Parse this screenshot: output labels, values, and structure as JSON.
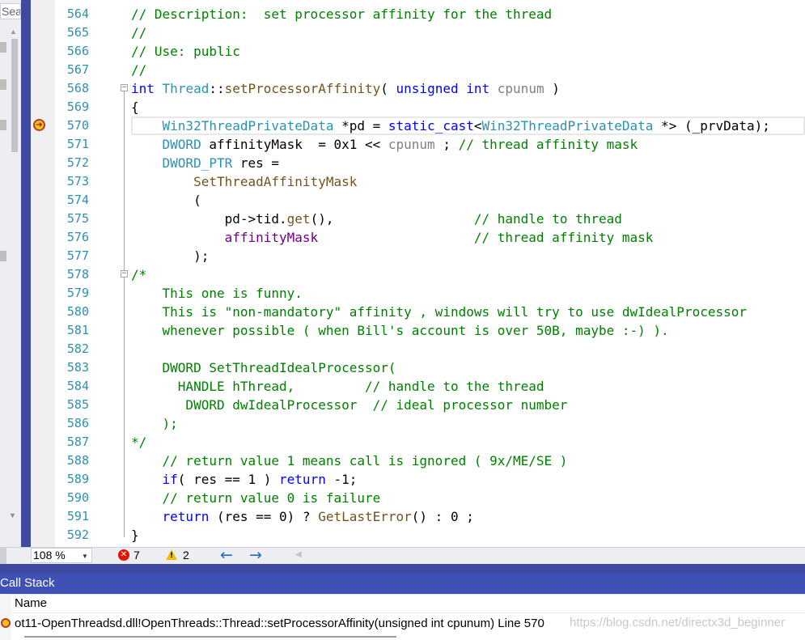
{
  "left_panel": {
    "search_text": "Sear"
  },
  "editor": {
    "lines": [
      {
        "n": "564",
        "segments": [
          {
            "c": "cm",
            "t": "// Description:  set processor affinity for the thread"
          }
        ]
      },
      {
        "n": "565",
        "segments": [
          {
            "c": "cm",
            "t": "//"
          }
        ]
      },
      {
        "n": "566",
        "segments": [
          {
            "c": "cm",
            "t": "// Use: public"
          }
        ]
      },
      {
        "n": "567",
        "segments": [
          {
            "c": "cm",
            "t": "//"
          }
        ]
      },
      {
        "n": "568",
        "segments": [
          {
            "c": "kw",
            "t": "int"
          },
          {
            "c": "",
            "t": " "
          },
          {
            "c": "ty",
            "t": "Thread"
          },
          {
            "c": "",
            "t": "::"
          },
          {
            "c": "fn",
            "t": "setProcessorAffinity"
          },
          {
            "c": "",
            "t": "( "
          },
          {
            "c": "kw",
            "t": "unsigned"
          },
          {
            "c": "",
            "t": " "
          },
          {
            "c": "kw",
            "t": "int"
          },
          {
            "c": "",
            "t": " "
          },
          {
            "c": "pm",
            "t": "cpunum"
          },
          {
            "c": "",
            "t": " )"
          }
        ]
      },
      {
        "n": "569",
        "segments": [
          {
            "c": "",
            "t": "{"
          }
        ]
      },
      {
        "n": "570",
        "segments": [
          {
            "c": "",
            "t": "    "
          },
          {
            "c": "ty",
            "t": "Win32ThreadPrivateData"
          },
          {
            "c": "",
            "t": " *pd = "
          },
          {
            "c": "kw",
            "t": "static_cast"
          },
          {
            "c": "",
            "t": "<"
          },
          {
            "c": "ty",
            "t": "Win32ThreadPrivateData"
          },
          {
            "c": "",
            "t": " *> (_prvData);"
          }
        ]
      },
      {
        "n": "571",
        "segments": [
          {
            "c": "",
            "t": "    "
          },
          {
            "c": "ty",
            "t": "DWORD"
          },
          {
            "c": "",
            "t": " affinityMask  = 0x1 << "
          },
          {
            "c": "pm",
            "t": "cpunum"
          },
          {
            "c": "",
            "t": " ; "
          },
          {
            "c": "cm",
            "t": "// thread affinity mask"
          }
        ]
      },
      {
        "n": "572",
        "segments": [
          {
            "c": "",
            "t": "    "
          },
          {
            "c": "ty",
            "t": "DWORD_PTR"
          },
          {
            "c": "",
            "t": " res ="
          }
        ]
      },
      {
        "n": "573",
        "segments": [
          {
            "c": "",
            "t": "        "
          },
          {
            "c": "fn",
            "t": "SetThreadAffinityMask"
          }
        ]
      },
      {
        "n": "574",
        "segments": [
          {
            "c": "",
            "t": "        ("
          }
        ]
      },
      {
        "n": "575",
        "segments": [
          {
            "c": "",
            "t": "            pd->tid."
          },
          {
            "c": "fn",
            "t": "get"
          },
          {
            "c": "",
            "t": "(),                  "
          },
          {
            "c": "cm",
            "t": "// handle to thread"
          }
        ]
      },
      {
        "n": "576",
        "segments": [
          {
            "c": "",
            "t": "            "
          },
          {
            "c": "mc",
            "t": "affinityMask"
          },
          {
            "c": "",
            "t": "                    "
          },
          {
            "c": "cm",
            "t": "// thread affinity mask"
          }
        ]
      },
      {
        "n": "577",
        "segments": [
          {
            "c": "",
            "t": "        );"
          }
        ]
      },
      {
        "n": "578",
        "segments": [
          {
            "c": "cm",
            "t": "/*"
          }
        ]
      },
      {
        "n": "579",
        "segments": [
          {
            "c": "cm",
            "t": "    This one is funny."
          }
        ]
      },
      {
        "n": "580",
        "segments": [
          {
            "c": "cm",
            "t": "    This is \"non-mandatory\" affinity , windows will try to use dwIdealProcessor"
          }
        ]
      },
      {
        "n": "581",
        "segments": [
          {
            "c": "cm",
            "t": "    whenever possible ( when Bill's account is over 50B, maybe :-) )."
          }
        ]
      },
      {
        "n": "582",
        "segments": [
          {
            "c": "cm",
            "t": ""
          }
        ]
      },
      {
        "n": "583",
        "segments": [
          {
            "c": "cm",
            "t": "    DWORD SetThreadIdealProcessor("
          }
        ]
      },
      {
        "n": "584",
        "segments": [
          {
            "c": "cm",
            "t": "      HANDLE hThread,         // handle to the thread"
          }
        ]
      },
      {
        "n": "585",
        "segments": [
          {
            "c": "cm",
            "t": "       DWORD dwIdealProcessor  // ideal processor number"
          }
        ]
      },
      {
        "n": "586",
        "segments": [
          {
            "c": "cm",
            "t": "    );"
          }
        ]
      },
      {
        "n": "587",
        "segments": [
          {
            "c": "cm",
            "t": "*/"
          }
        ]
      },
      {
        "n": "588",
        "segments": [
          {
            "c": "",
            "t": "    "
          },
          {
            "c": "cm",
            "t": "// return value 1 means call is ignored ( 9x/ME/SE )"
          }
        ]
      },
      {
        "n": "589",
        "segments": [
          {
            "c": "",
            "t": "    "
          },
          {
            "c": "kw",
            "t": "if"
          },
          {
            "c": "",
            "t": "( res == 1 ) "
          },
          {
            "c": "kw",
            "t": "return"
          },
          {
            "c": "",
            "t": " -1;"
          }
        ]
      },
      {
        "n": "590",
        "segments": [
          {
            "c": "",
            "t": "    "
          },
          {
            "c": "cm",
            "t": "// return value 0 is failure"
          }
        ]
      },
      {
        "n": "591",
        "segments": [
          {
            "c": "",
            "t": "    "
          },
          {
            "c": "kw",
            "t": "return"
          },
          {
            "c": "",
            "t": " (res == 0) ? "
          },
          {
            "c": "fn",
            "t": "GetLastError"
          },
          {
            "c": "",
            "t": "() : 0 ;"
          }
        ]
      },
      {
        "n": "592",
        "segments": [
          {
            "c": "",
            "t": "}"
          }
        ]
      }
    ],
    "current_line": "570"
  },
  "status_bar": {
    "zoom": "108 %",
    "error_count": "7",
    "warning_count": "2",
    "back_glyph": "🡐",
    "forward_glyph": "🡒"
  },
  "call_stack": {
    "title": "Call Stack",
    "column_name": "Name",
    "frames": [
      {
        "text": "ot11-OpenThreadsd.dll!OpenThreads::Thread::setProcessorAffinity(unsigned int cpunum) Line 570"
      }
    ],
    "watermark": "https://blog.csdn.net/directx3d_beginner"
  },
  "colors": {
    "accent_blue": "#3f51b5",
    "line_number": "#2b91af",
    "comment": "#008000",
    "keyword": "#0000ff",
    "type": "#2b91af"
  }
}
